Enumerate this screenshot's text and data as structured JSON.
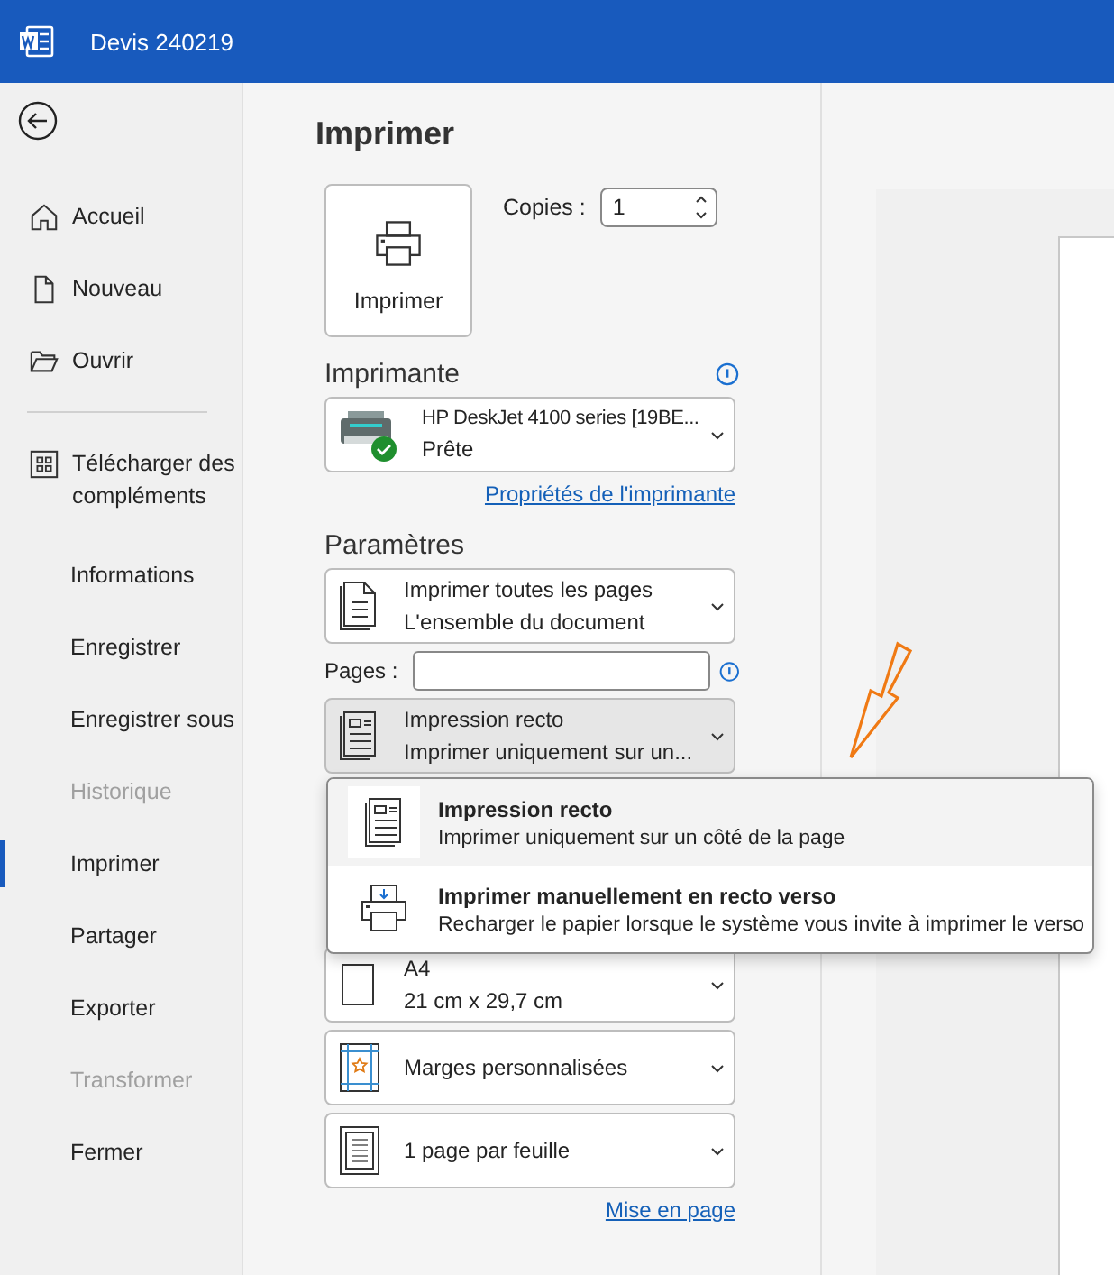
{
  "window": {
    "title": "Devis 240219"
  },
  "sidebar": {
    "items": [
      {
        "kind": "home",
        "label": "Accueil",
        "selected": false,
        "disabled": false
      },
      {
        "kind": "new",
        "label": "Nouveau",
        "selected": false,
        "disabled": false
      },
      {
        "kind": "open",
        "label": "Ouvrir",
        "selected": false,
        "disabled": false
      },
      {
        "kind": "separator"
      },
      {
        "kind": "addins",
        "label": "Télécharger des compléments",
        "selected": false,
        "disabled": false
      },
      {
        "kind": "text",
        "label": "Informations",
        "selected": false,
        "disabled": false
      },
      {
        "kind": "text",
        "label": "Enregistrer",
        "selected": false,
        "disabled": false
      },
      {
        "kind": "text",
        "label": "Enregistrer sous",
        "selected": false,
        "disabled": false
      },
      {
        "kind": "text",
        "label": "Historique",
        "selected": false,
        "disabled": true
      },
      {
        "kind": "text",
        "label": "Imprimer",
        "selected": true,
        "disabled": false
      },
      {
        "kind": "text",
        "label": "Partager",
        "selected": false,
        "disabled": false
      },
      {
        "kind": "text",
        "label": "Exporter",
        "selected": false,
        "disabled": false
      },
      {
        "kind": "text",
        "label": "Transformer",
        "selected": false,
        "disabled": true
      },
      {
        "kind": "text",
        "label": "Fermer",
        "selected": false,
        "disabled": false
      }
    ]
  },
  "print": {
    "heading": "Imprimer",
    "button": "Imprimer",
    "copies": {
      "label": "Copies :",
      "value": "1"
    }
  },
  "printer": {
    "heading": "Imprimante",
    "name": "HP DeskJet 4100 series [19BE...",
    "status": "Prête",
    "link": "Propriétés de l'imprimante"
  },
  "settings": {
    "heading": "Paramètres",
    "pages_label": "Pages :",
    "link": "Mise en page",
    "dropdowns": [
      {
        "kind": "pages",
        "line1": "Imprimer toutes les pages",
        "line2": "L'ensemble du document",
        "expanded": false
      },
      {
        "kind": "pages-field"
      },
      {
        "kind": "recto",
        "line1": "Impression recto",
        "line2": "Imprimer uniquement sur un...",
        "expanded": true,
        "menu": [
          {
            "kind": "recto",
            "title": "Impression recto",
            "description": "Imprimer uniquement sur un côté de la page",
            "selected": true
          },
          {
            "kind": "duplex",
            "title": "Imprimer manuellement en recto verso",
            "description": "Recharger le papier lorsque le système vous invite à imprimer le verso",
            "selected": false
          }
        ]
      },
      {
        "kind": "hidden"
      },
      {
        "kind": "hidden"
      },
      {
        "kind": "paper",
        "line1": "A4",
        "line2": "21 cm x 29,7 cm",
        "expanded": false
      },
      {
        "kind": "margins",
        "line1": "Marges personnalisées",
        "expanded": false
      },
      {
        "kind": "sheet",
        "line1": "1 page par feuille",
        "expanded": false
      }
    ]
  }
}
